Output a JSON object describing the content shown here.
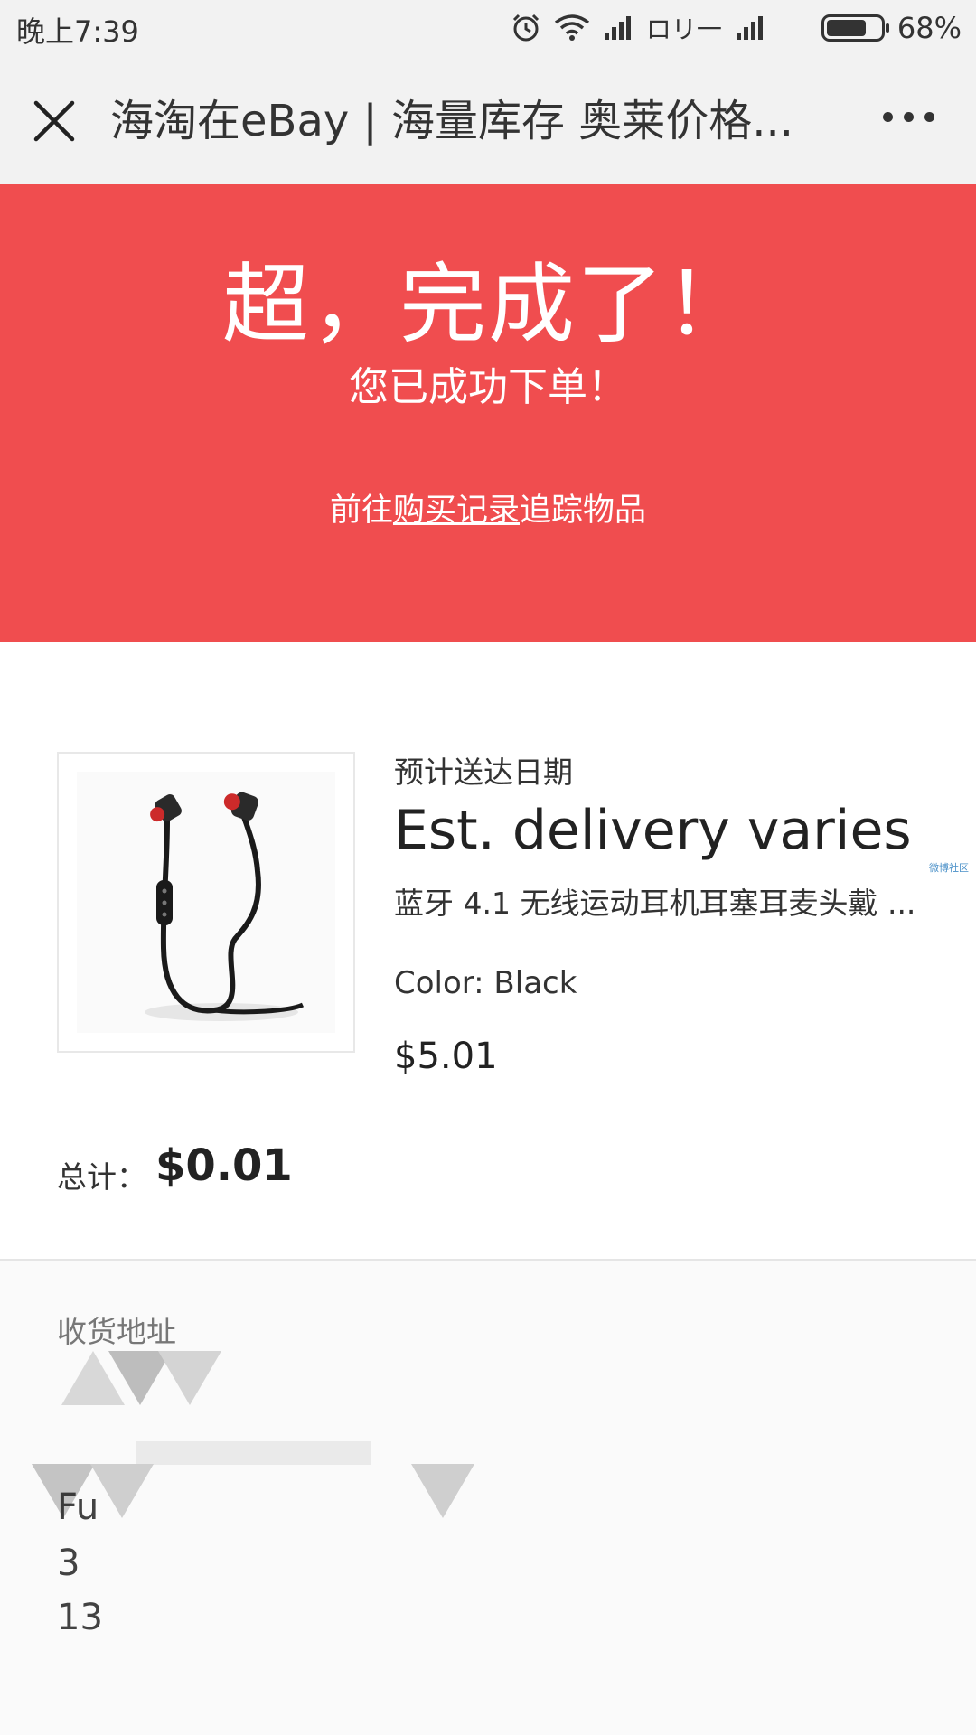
{
  "status_bar": {
    "time": "晚上7:39",
    "carrier": "ロリ一",
    "battery": "68%"
  },
  "header": {
    "title": "海淘在eBay | 海量库存 奥莱价格...",
    "close_icon": "close-icon",
    "more_icon": "more-icon"
  },
  "banner": {
    "heading": "超，完成了！",
    "subheading": "您已成功下单！",
    "link_prefix": "前往",
    "link_text": "购买记录",
    "link_suffix": "追踪物品",
    "color": "#f04d4f"
  },
  "order": {
    "delivery_label": "预计送达日期",
    "delivery_value": "Est. delivery varies",
    "product_title": "蓝牙 4.1 无线运动耳机耳塞耳麦头戴 ...",
    "product_color": "Color: Black",
    "product_price": "$5.01",
    "total_label": "总计：",
    "total_value": "$0.01"
  },
  "side_watermark": "微博社区",
  "address": {
    "label": "收货地址",
    "line1": "Fu",
    "line2": "3",
    "line3": "13"
  }
}
